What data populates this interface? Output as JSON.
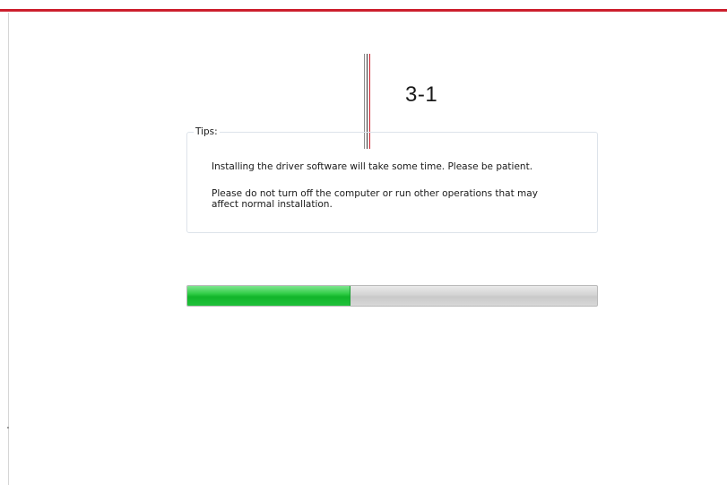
{
  "annotation": {
    "label": "3-1",
    "line_colors": [
      "#8a8a8a",
      "#3a3a3a",
      "#cc1f2d"
    ]
  },
  "tips": {
    "legend": "Tips:",
    "line1": "Installing the driver software will take some time. Please be patient.",
    "line2a": "Please do not turn off the computer or run other operations that may",
    "line2b": "affect normal installation."
  },
  "progress": {
    "fraction": 0.395,
    "fill_color": "#1fc13a",
    "track_color": "#d4d4d4"
  },
  "colors": {
    "accent": "#cc1f2d",
    "background": "#ffffff"
  }
}
